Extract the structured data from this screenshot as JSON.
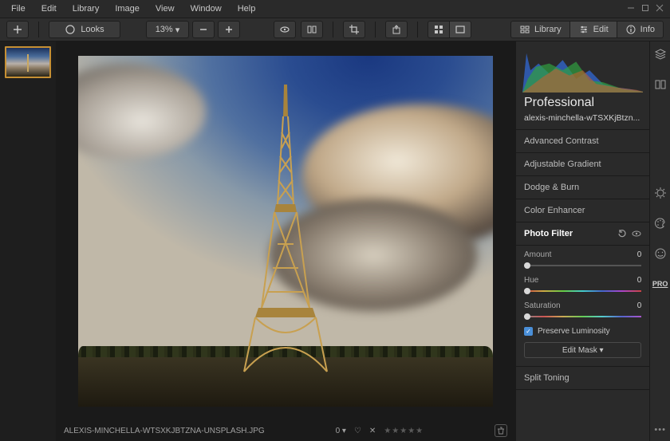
{
  "menu": [
    "File",
    "Edit",
    "Library",
    "Image",
    "View",
    "Window",
    "Help"
  ],
  "toolbar": {
    "looks": "Looks",
    "zoom": "13%",
    "tabs": {
      "library": "Library",
      "edit": "Edit",
      "info": "Info"
    }
  },
  "preset": {
    "title": "Professional",
    "filename": "alexis-minchella-wTSXKjBtzn..."
  },
  "panels": [
    "Advanced Contrast",
    "Adjustable Gradient",
    "Dodge & Burn",
    "Color Enhancer"
  ],
  "photo_filter": {
    "label": "Photo Filter",
    "amount": {
      "label": "Amount",
      "value": "0"
    },
    "hue": {
      "label": "Hue",
      "value": "0"
    },
    "saturation": {
      "label": "Saturation",
      "value": "0"
    },
    "preserve": "Preserve Luminosity",
    "mask": "Edit Mask ▾"
  },
  "panel_after": "Split Toning",
  "status": {
    "filename": "ALEXIS-MINCHELLA-WTSXKJBTZNA-UNSPLASH.JPG",
    "flag": "0 ▾",
    "rating": "★★★★★",
    "reject": "✕"
  },
  "rail": {
    "pro": "PRO"
  }
}
